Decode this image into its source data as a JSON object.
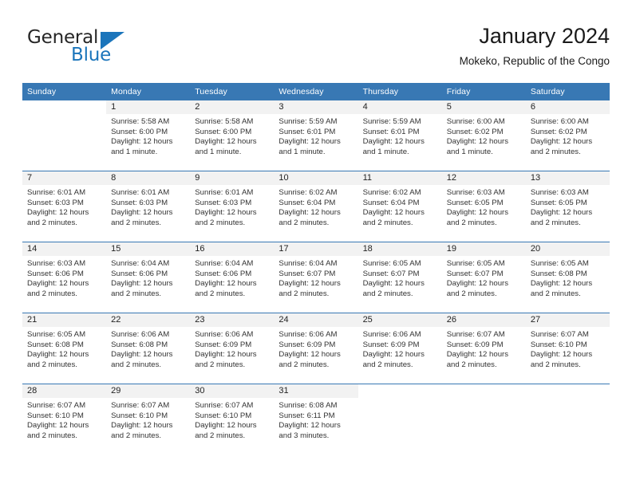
{
  "brand": {
    "name_part1": "General",
    "name_part2": "Blue",
    "flag_icon": "triangle-flag-icon",
    "accent_color": "#1b75bb"
  },
  "header": {
    "title": "January 2024",
    "subtitle": "Mokeko, Republic of the Congo"
  },
  "theme": {
    "header_row_bg": "#3878b4",
    "daynum_bg": "#f2f2f2",
    "separator": "#3878b4",
    "text": "#333333"
  },
  "weekday_headers": [
    "Sunday",
    "Monday",
    "Tuesday",
    "Wednesday",
    "Thursday",
    "Friday",
    "Saturday"
  ],
  "labels": {
    "sunrise": "Sunrise:",
    "sunset": "Sunset:",
    "daylight": "Daylight:"
  },
  "weeks": [
    [
      {
        "day": "",
        "lines": []
      },
      {
        "day": "1",
        "lines": [
          "Sunrise: 5:58 AM",
          "Sunset: 6:00 PM",
          "Daylight: 12 hours",
          "and 1 minute."
        ]
      },
      {
        "day": "2",
        "lines": [
          "Sunrise: 5:58 AM",
          "Sunset: 6:00 PM",
          "Daylight: 12 hours",
          "and 1 minute."
        ]
      },
      {
        "day": "3",
        "lines": [
          "Sunrise: 5:59 AM",
          "Sunset: 6:01 PM",
          "Daylight: 12 hours",
          "and 1 minute."
        ]
      },
      {
        "day": "4",
        "lines": [
          "Sunrise: 5:59 AM",
          "Sunset: 6:01 PM",
          "Daylight: 12 hours",
          "and 1 minute."
        ]
      },
      {
        "day": "5",
        "lines": [
          "Sunrise: 6:00 AM",
          "Sunset: 6:02 PM",
          "Daylight: 12 hours",
          "and 1 minute."
        ]
      },
      {
        "day": "6",
        "lines": [
          "Sunrise: 6:00 AM",
          "Sunset: 6:02 PM",
          "Daylight: 12 hours",
          "and 2 minutes."
        ]
      }
    ],
    [
      {
        "day": "7",
        "lines": [
          "Sunrise: 6:01 AM",
          "Sunset: 6:03 PM",
          "Daylight: 12 hours",
          "and 2 minutes."
        ]
      },
      {
        "day": "8",
        "lines": [
          "Sunrise: 6:01 AM",
          "Sunset: 6:03 PM",
          "Daylight: 12 hours",
          "and 2 minutes."
        ]
      },
      {
        "day": "9",
        "lines": [
          "Sunrise: 6:01 AM",
          "Sunset: 6:03 PM",
          "Daylight: 12 hours",
          "and 2 minutes."
        ]
      },
      {
        "day": "10",
        "lines": [
          "Sunrise: 6:02 AM",
          "Sunset: 6:04 PM",
          "Daylight: 12 hours",
          "and 2 minutes."
        ]
      },
      {
        "day": "11",
        "lines": [
          "Sunrise: 6:02 AM",
          "Sunset: 6:04 PM",
          "Daylight: 12 hours",
          "and 2 minutes."
        ]
      },
      {
        "day": "12",
        "lines": [
          "Sunrise: 6:03 AM",
          "Sunset: 6:05 PM",
          "Daylight: 12 hours",
          "and 2 minutes."
        ]
      },
      {
        "day": "13",
        "lines": [
          "Sunrise: 6:03 AM",
          "Sunset: 6:05 PM",
          "Daylight: 12 hours",
          "and 2 minutes."
        ]
      }
    ],
    [
      {
        "day": "14",
        "lines": [
          "Sunrise: 6:03 AM",
          "Sunset: 6:06 PM",
          "Daylight: 12 hours",
          "and 2 minutes."
        ]
      },
      {
        "day": "15",
        "lines": [
          "Sunrise: 6:04 AM",
          "Sunset: 6:06 PM",
          "Daylight: 12 hours",
          "and 2 minutes."
        ]
      },
      {
        "day": "16",
        "lines": [
          "Sunrise: 6:04 AM",
          "Sunset: 6:06 PM",
          "Daylight: 12 hours",
          "and 2 minutes."
        ]
      },
      {
        "day": "17",
        "lines": [
          "Sunrise: 6:04 AM",
          "Sunset: 6:07 PM",
          "Daylight: 12 hours",
          "and 2 minutes."
        ]
      },
      {
        "day": "18",
        "lines": [
          "Sunrise: 6:05 AM",
          "Sunset: 6:07 PM",
          "Daylight: 12 hours",
          "and 2 minutes."
        ]
      },
      {
        "day": "19",
        "lines": [
          "Sunrise: 6:05 AM",
          "Sunset: 6:07 PM",
          "Daylight: 12 hours",
          "and 2 minutes."
        ]
      },
      {
        "day": "20",
        "lines": [
          "Sunrise: 6:05 AM",
          "Sunset: 6:08 PM",
          "Daylight: 12 hours",
          "and 2 minutes."
        ]
      }
    ],
    [
      {
        "day": "21",
        "lines": [
          "Sunrise: 6:05 AM",
          "Sunset: 6:08 PM",
          "Daylight: 12 hours",
          "and 2 minutes."
        ]
      },
      {
        "day": "22",
        "lines": [
          "Sunrise: 6:06 AM",
          "Sunset: 6:08 PM",
          "Daylight: 12 hours",
          "and 2 minutes."
        ]
      },
      {
        "day": "23",
        "lines": [
          "Sunrise: 6:06 AM",
          "Sunset: 6:09 PM",
          "Daylight: 12 hours",
          "and 2 minutes."
        ]
      },
      {
        "day": "24",
        "lines": [
          "Sunrise: 6:06 AM",
          "Sunset: 6:09 PM",
          "Daylight: 12 hours",
          "and 2 minutes."
        ]
      },
      {
        "day": "25",
        "lines": [
          "Sunrise: 6:06 AM",
          "Sunset: 6:09 PM",
          "Daylight: 12 hours",
          "and 2 minutes."
        ]
      },
      {
        "day": "26",
        "lines": [
          "Sunrise: 6:07 AM",
          "Sunset: 6:09 PM",
          "Daylight: 12 hours",
          "and 2 minutes."
        ]
      },
      {
        "day": "27",
        "lines": [
          "Sunrise: 6:07 AM",
          "Sunset: 6:10 PM",
          "Daylight: 12 hours",
          "and 2 minutes."
        ]
      }
    ],
    [
      {
        "day": "28",
        "lines": [
          "Sunrise: 6:07 AM",
          "Sunset: 6:10 PM",
          "Daylight: 12 hours",
          "and 2 minutes."
        ]
      },
      {
        "day": "29",
        "lines": [
          "Sunrise: 6:07 AM",
          "Sunset: 6:10 PM",
          "Daylight: 12 hours",
          "and 2 minutes."
        ]
      },
      {
        "day": "30",
        "lines": [
          "Sunrise: 6:07 AM",
          "Sunset: 6:10 PM",
          "Daylight: 12 hours",
          "and 2 minutes."
        ]
      },
      {
        "day": "31",
        "lines": [
          "Sunrise: 6:08 AM",
          "Sunset: 6:11 PM",
          "Daylight: 12 hours",
          "and 3 minutes."
        ]
      },
      {
        "day": "",
        "lines": []
      },
      {
        "day": "",
        "lines": []
      },
      {
        "day": "",
        "lines": []
      }
    ]
  ]
}
